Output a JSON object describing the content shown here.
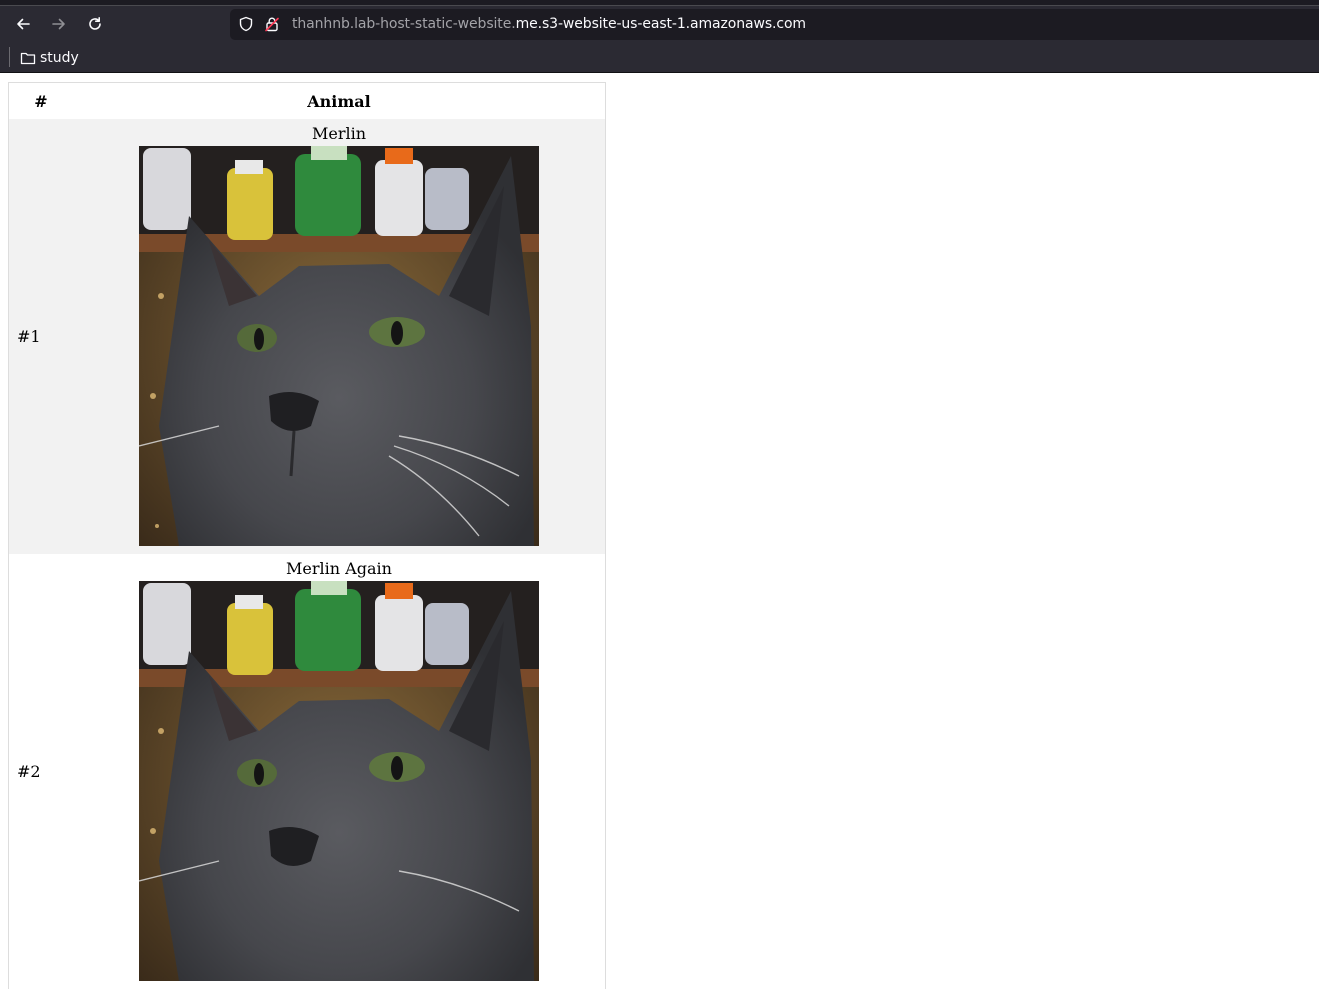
{
  "browser": {
    "url_host_prefix": "thanhnb.lab-host-static-website.",
    "url_host_main": "me.s3-website-us-east-1.amazonaws.com",
    "bookmarks": [
      {
        "label": "study",
        "icon": "folder-icon"
      }
    ]
  },
  "table": {
    "headers": {
      "number": "#",
      "animal": "Animal"
    },
    "rows": [
      {
        "number": "#1",
        "name": "Merlin",
        "image": "gray-cat-photo"
      },
      {
        "number": "#2",
        "name": "Merlin Again",
        "image": "gray-cat-photo"
      }
    ]
  }
}
